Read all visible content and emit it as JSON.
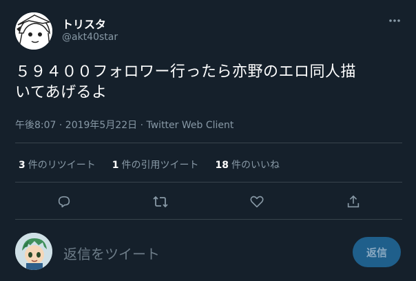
{
  "tweet": {
    "display_name": "トリスタ",
    "handle": "@akt40star",
    "text_line1": "５９４００フォロワー行ったら亦野のエロ同人描",
    "text_line2": "いてあげるよ",
    "timestamp": "午後8:07 · 2019年5月22日 · Twitter Web Client",
    "more_icon": "more-horizontal-icon"
  },
  "stats": {
    "retweets_count": "3",
    "retweets_label": "件のリツイート",
    "quotes_count": "1",
    "quotes_label": "件の引用ツイート",
    "likes_count": "18",
    "likes_label": "件のいいね"
  },
  "actions": {
    "reply_icon": "reply-icon",
    "retweet_icon": "retweet-icon",
    "like_icon": "heart-icon",
    "share_icon": "share-icon"
  },
  "reply_box": {
    "placeholder": "返信をツイート",
    "button_label": "返信"
  },
  "colors": {
    "background": "#15202b",
    "divider": "#38444d",
    "secondary_text": "#8899a6",
    "reply_button": "#1f5f8b"
  }
}
